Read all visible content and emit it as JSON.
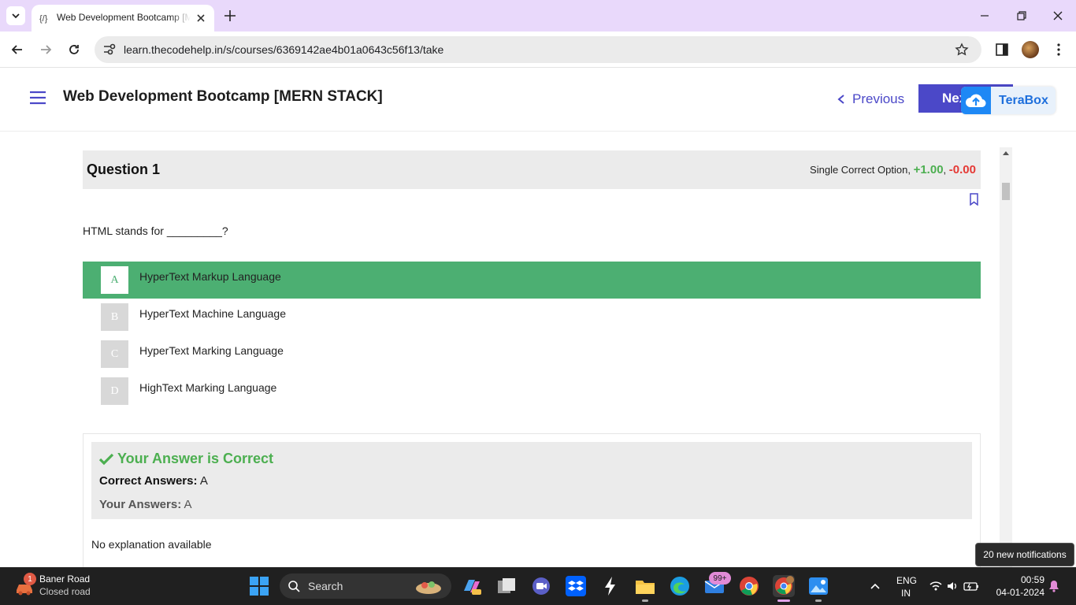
{
  "browser": {
    "tab_title": "Web Development Bootcamp [MERN STACK]",
    "url": "learn.thecodehelp.in/s/courses/6369142ae4b01a0643c56f13/take"
  },
  "header": {
    "course_title": "Web Development Bootcamp [MERN STACK]",
    "previous_label": "Previous",
    "next_label": "Next",
    "terabox_label": "TeraBox"
  },
  "question": {
    "title": "Question 1",
    "type_label": "Single Correct Option,",
    "plus_marks": "+1.00",
    "separator": ",",
    "minus_marks": "-0.00",
    "text": "HTML stands for _________?",
    "options": [
      {
        "letter": "A",
        "text": "HyperText Markup Language",
        "selected": true
      },
      {
        "letter": "B",
        "text": "HyperText Machine Language",
        "selected": false
      },
      {
        "letter": "C",
        "text": "HyperText Marking Language",
        "selected": false
      },
      {
        "letter": "D",
        "text": "HighText Marking Language",
        "selected": false
      }
    ]
  },
  "result": {
    "status": "Your Answer is Correct",
    "correct_label": "Correct Answers:",
    "correct_value": "A",
    "your_label": "Your Answers:",
    "your_value": "A",
    "explanation": "No explanation available"
  },
  "notification_toast": "20 new notifications",
  "taskbar": {
    "weather_title": "Baner Road",
    "weather_sub": "Closed road",
    "weather_badge": "1",
    "search_label": "Search",
    "mail_badge": "99+",
    "lang_line1": "ENG",
    "lang_line2": "IN",
    "time": "00:59",
    "date": "04-01-2024"
  },
  "colors": {
    "accent": "#4b48c8",
    "correct_green": "#4caf72",
    "status_green": "#4caf50",
    "negative_red": "#e53935",
    "tab_strip": "#e9d9fb"
  }
}
